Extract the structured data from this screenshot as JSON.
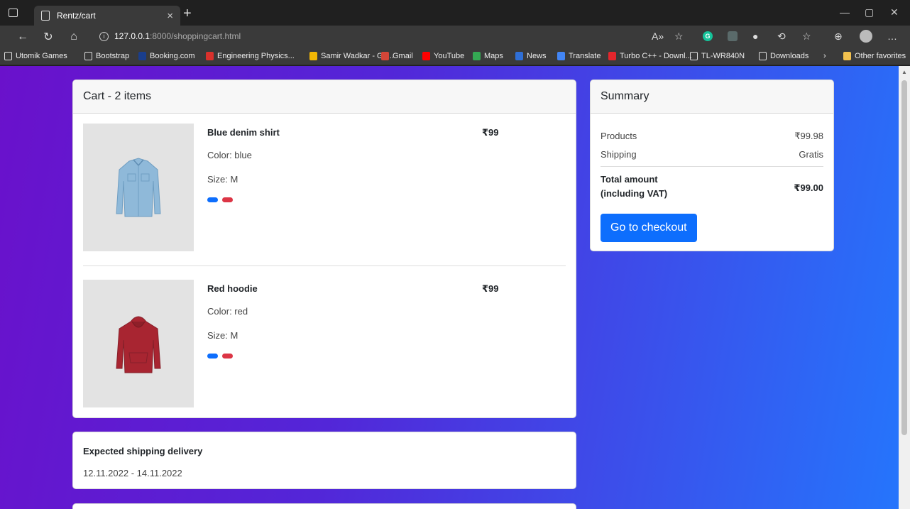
{
  "browser": {
    "tab_title": "Rentz/cart",
    "url_host": "127.0.0.1",
    "url_rest": ":8000/shoppingcart.html",
    "bookmarks": [
      {
        "label": "Utomik Games",
        "color": "page"
      },
      {
        "label": "Bootstrap",
        "color": "page"
      },
      {
        "label": "Booking.com",
        "color": "#1a3e8c"
      },
      {
        "label": "Engineering Physics...",
        "color": "#d9312c"
      },
      {
        "label": "Samir Wadkar - Go...",
        "color": "#f2b705"
      },
      {
        "label": "Gmail",
        "color": "#d44638"
      },
      {
        "label": "YouTube",
        "color": "#ff0000"
      },
      {
        "label": "Maps",
        "color": "#34a853"
      },
      {
        "label": "News",
        "color": "#2f6fd6"
      },
      {
        "label": "Translate",
        "color": "#4285f4"
      },
      {
        "label": "Turbo C++ - Downl...",
        "color": "#e3262c"
      },
      {
        "label": "TL-WR840N",
        "color": "page"
      },
      {
        "label": "Downloads",
        "color": "page"
      }
    ],
    "other_favorites": "Other favorites"
  },
  "cart": {
    "header": "Cart - 2 items",
    "items": [
      {
        "name": "Blue denim shirt",
        "price": "₹99",
        "color": "Color: blue",
        "size": "Size: M",
        "swatches": [
          "#0d6efd",
          "#dc3545"
        ],
        "icon": "denim-shirt-image"
      },
      {
        "name": "Red hoodie",
        "price": "₹99",
        "color": "Color: red",
        "size": "Size: M",
        "swatches": [
          "#0d6efd",
          "#dc3545"
        ],
        "icon": "red-hoodie-image"
      }
    ]
  },
  "summary": {
    "header": "Summary",
    "products_label": "Products",
    "products_value": "₹99.98",
    "shipping_label": "Shipping",
    "shipping_value": "Gratis",
    "total_label_1": "Total amount",
    "total_label_2": "(including VAT)",
    "total_value": "₹99.00",
    "checkout_label": "Go to checkout",
    "accent": "#0d6efd"
  },
  "shipping": {
    "title": "Expected shipping delivery",
    "dates": "12.11.2022 - 14.11.2022"
  }
}
